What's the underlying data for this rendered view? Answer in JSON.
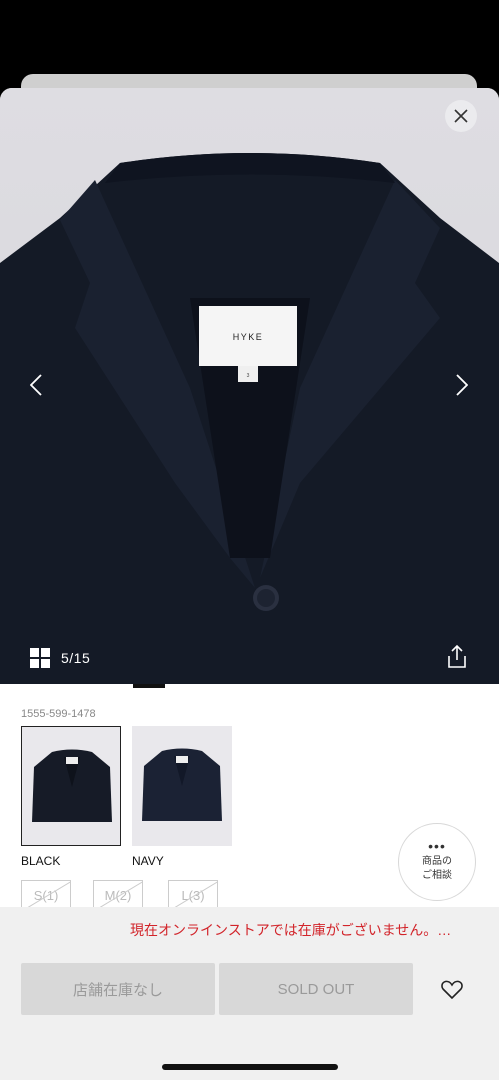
{
  "gallery": {
    "counter": "5/15",
    "label_brand": "HYKE",
    "label_size": "3"
  },
  "product": {
    "code": "1555-599-1478"
  },
  "colors": [
    {
      "label": "BLACK",
      "selected": true
    },
    {
      "label": "NAVY",
      "selected": false
    }
  ],
  "consult": {
    "dots": "•••",
    "line1": "商品の",
    "line2": "ご相談"
  },
  "sizes": [
    {
      "label": "S(1)"
    },
    {
      "label": "M(2)"
    },
    {
      "label": "L(3)"
    }
  ],
  "footer": {
    "stock_message": "現在オンラインストアでは在庫がございません。…",
    "store_button": "店舗在庫なし",
    "sold_out_button": "SOLD OUT"
  },
  "theme": {
    "accent_red": "#d2242a",
    "garment": "#141a26"
  },
  "icons": [
    "close-icon",
    "chevron-left-icon",
    "chevron-right-icon",
    "grid-icon",
    "share-icon",
    "heart-icon"
  ]
}
